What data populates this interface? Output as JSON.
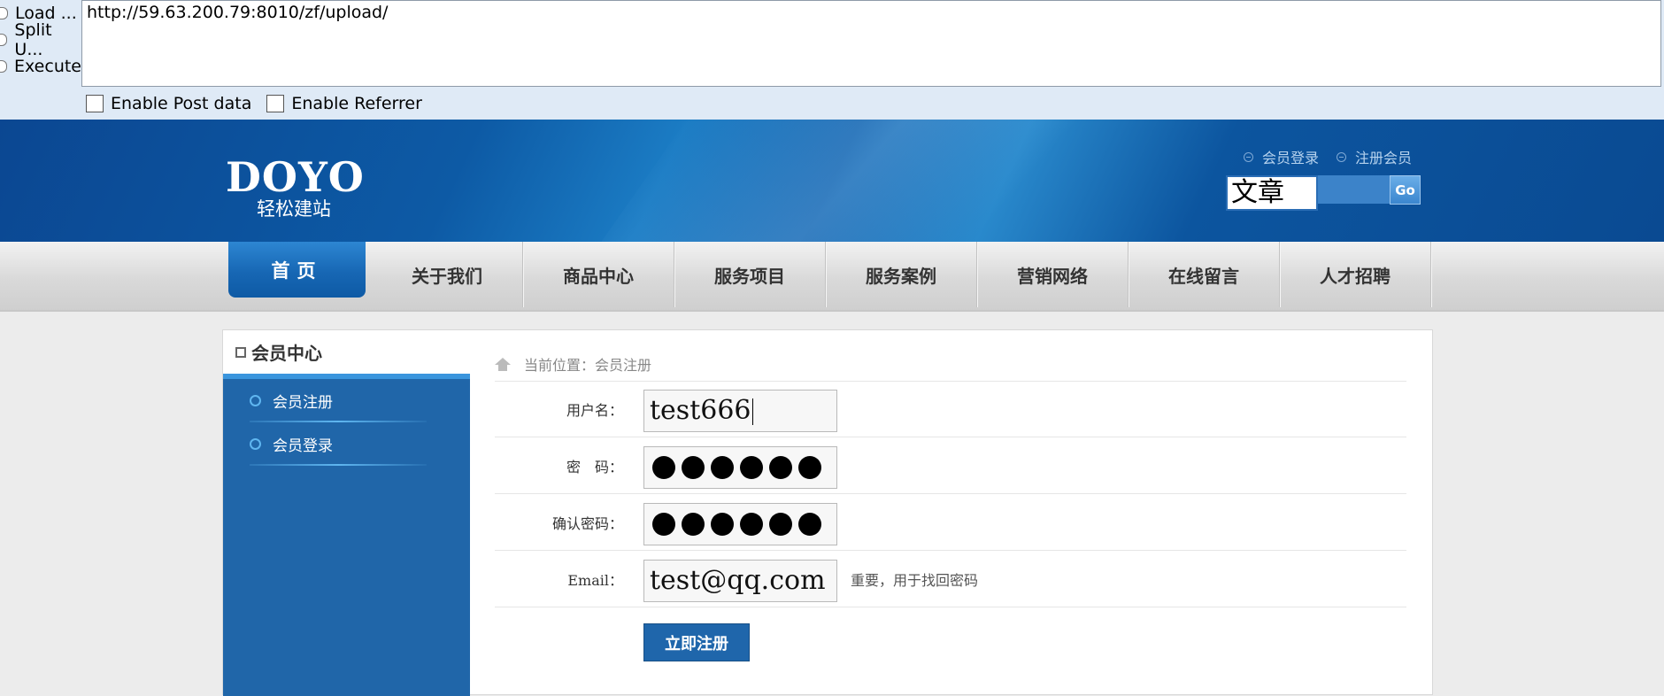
{
  "hackbar": {
    "side_items": [
      "Load ...",
      "Split U...",
      "Execute"
    ],
    "url": "http://59.63.200.79:8010/zf/upload/",
    "enable_post": "Enable Post data",
    "enable_referrer": "Enable Referrer"
  },
  "header": {
    "logo": "DOYO",
    "logo_sub": "轻松建站",
    "member_login": "会员登录",
    "register_member": "注册会员",
    "search_value": "文章",
    "go_label": "Go"
  },
  "nav": {
    "items": [
      "首页",
      "关于我们",
      "商品中心",
      "服务项目",
      "服务案例",
      "营销网络",
      "在线留言",
      "人才招聘"
    ]
  },
  "sidebar": {
    "title": "会员中心",
    "items": [
      "会员注册",
      "会员登录"
    ]
  },
  "main": {
    "breadcrumb": "当前位置：会员注册",
    "username_label": "用户名：",
    "username_value": "test666",
    "password_label": "密　码：",
    "password_length": 6,
    "confirm_label": "确认密码：",
    "confirm_length": 6,
    "email_label": "Email：",
    "email_value": "test@qq.com",
    "email_hint": "重要，用于找回密码",
    "submit_label": "立即注册"
  },
  "colors": {
    "header_blue": "#0d5aa5",
    "sidebar_blue": "#2066a9",
    "submit_blue": "#1f66ab"
  }
}
